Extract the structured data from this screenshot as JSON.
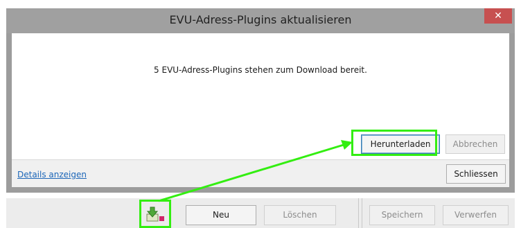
{
  "dialog": {
    "title": "EVU-Adress-Plugins aktualisieren",
    "close_symbol": "✕",
    "message": "5 EVU-Adress-Plugins stehen zum Download bereit.",
    "buttons": {
      "download": "Herunterladen",
      "cancel": "Abbrechen",
      "close": "Schliessen"
    },
    "details_link": "Details anzeigen"
  },
  "toolbar": {
    "icon": "download-icon",
    "new": "Neu",
    "delete": "Löschen",
    "save": "Speichern",
    "discard": "Verwerfen"
  },
  "colors": {
    "highlight": "#33ee11",
    "close_button": "#c75050",
    "link": "#1c66b8"
  }
}
